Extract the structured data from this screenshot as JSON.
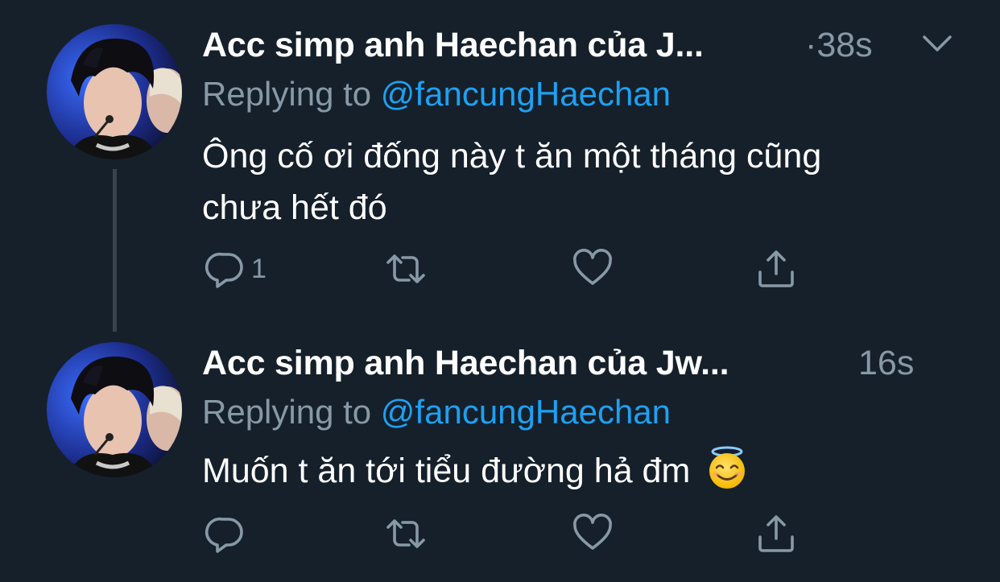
{
  "tweets": [
    {
      "author": "Acc simp anh Haechan của J...",
      "timestamp": "·38s",
      "replying_prefix": "Replying to",
      "replying_handle": "@fancungHaechan",
      "text_line1": "Ông cố ơi đống này t ăn một tháng cũng",
      "text_line2": "chưa hết đó",
      "reply_count": "1",
      "icons": [
        "reply-icon",
        "retweet-icon",
        "like-icon",
        "share-icon",
        "chevron-down-icon"
      ]
    },
    {
      "author": "Acc simp anh Haechan của Jw...",
      "timestamp": "16s",
      "replying_prefix": "Replying to",
      "replying_handle": "@fancungHaechan",
      "text": "Muốn t ăn tới tiểu đường hả đm",
      "emoji": "smiling-face-with-halo",
      "reply_count": "",
      "icons": [
        "reply-icon",
        "retweet-icon",
        "like-icon",
        "share-icon"
      ]
    }
  ],
  "colors": {
    "background": "#15202b",
    "text_primary": "#ffffff",
    "text_secondary": "#8899a6",
    "link": "#1da1f2",
    "thread_line": "#38444d"
  }
}
